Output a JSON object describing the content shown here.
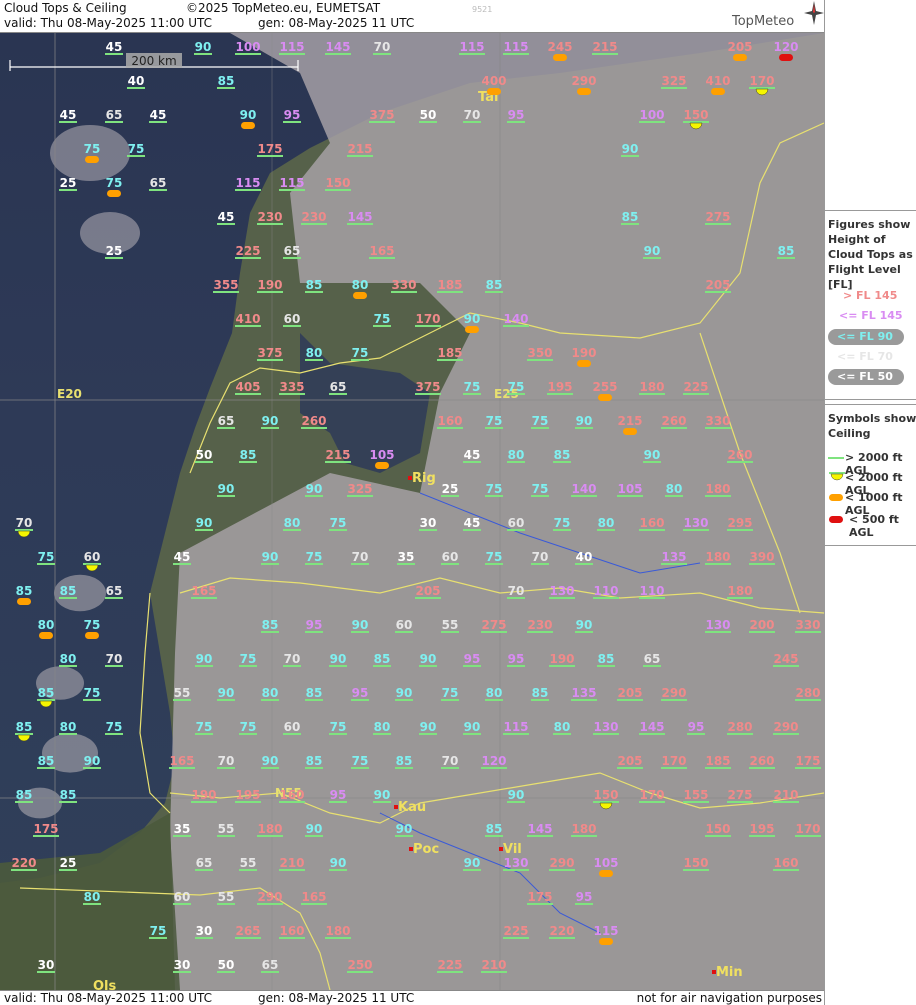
{
  "header": {
    "title": "Cloud Tops & Ceiling",
    "copyright": "©2025 TopMeteo.eu, EUMETSAT",
    "valid": "valid:  Thu  08-May-2025  11:00 UTC",
    "generated": "gen: 08-May-2025 11 UTC",
    "code": "9521",
    "logo": "TopMeteo"
  },
  "footer": {
    "valid": "valid:  Thu  08-May-2025  11:00 UTC",
    "generated": "gen: 08-May-2025 11 UTC",
    "note": "not for air navigation purposes"
  },
  "map": {
    "scale_label": "200 km",
    "grid_labels": {
      "lon1": "E20",
      "lon2": "E25",
      "lat1": "N55"
    },
    "cities": [
      "Tal",
      "Rig",
      "Kau",
      "Poc",
      "Vil",
      "Min",
      "Ols"
    ],
    "colors": {
      "above145": "#f08a8a",
      "le145": "#d98cf2",
      "le90": "#7ff0f0",
      "le70": "#e6e6e6",
      "le50": "#ffffff",
      "ceil_gt2000": "#7fe37f",
      "ceil_lt2000": "#f5f500",
      "ceil_lt1000": "#ffa000",
      "ceil_lt500": "#e01010"
    }
  },
  "legend": {
    "tops_title": "Figures show Height of Cloud Tops as Flight Level  [FL]",
    "tops_items": [
      "> FL 145",
      "<= FL 145",
      "<= FL 90",
      "<= FL 70",
      "<= FL 50"
    ],
    "ceiling_title": "Symbols show Ceiling",
    "ceiling_items": [
      "> 2000 ft AGL",
      "< 2000 ft AGL",
      "< 1000 ft AGL",
      "< 500 ft AGL"
    ]
  }
}
